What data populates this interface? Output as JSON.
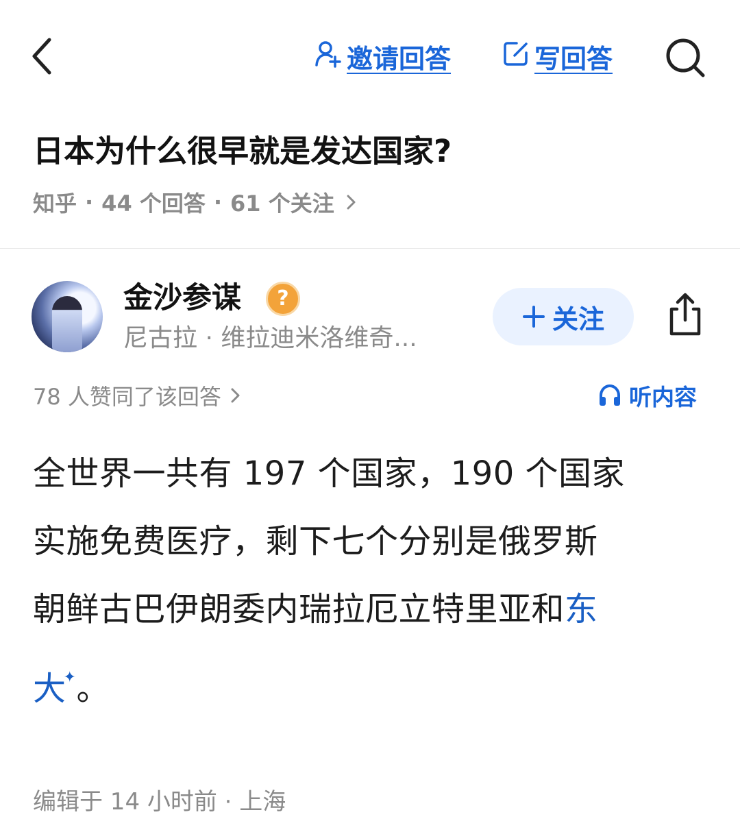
{
  "nav": {
    "invite_label": "邀请回答",
    "write_label": "写回答",
    "accent": "#1a66d9"
  },
  "question": {
    "title": "日本为什么很早就是发达国家?",
    "source": "知乎",
    "answers_count": "44 个回答",
    "follows_count": "61 个关注"
  },
  "author": {
    "name": "金沙参谋",
    "badge": "?",
    "bio": "尼古拉 · 维拉迪米洛维奇...",
    "follow_label": "关注"
  },
  "votes": {
    "text": "78 人赞同了该回答"
  },
  "listen_label": "听内容",
  "answer": {
    "line1": "全世界一共有 197 个国家，190 个国家",
    "line2": "实施免费医疗，剩下七个分别是俄罗斯",
    "line3": "朝鲜古巴伊朗委内瑞拉厄立特里亚和",
    "line3_keyword": "东",
    "line4_keyword": "大",
    "line4_tail": "。"
  },
  "footer": {
    "edited": "编辑于 14 小时前 · 上海"
  },
  "icons": [
    "back-icon",
    "invite-user-icon",
    "edit-icon",
    "search-icon",
    "share-icon",
    "headphones-icon",
    "chevron-right-icon",
    "sparkle-icon"
  ]
}
